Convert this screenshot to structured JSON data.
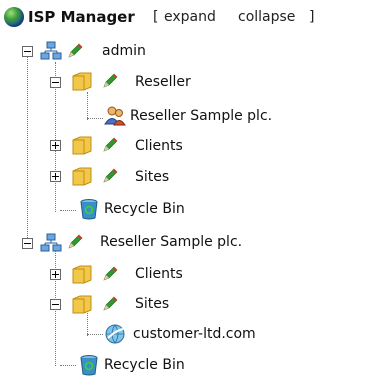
{
  "header": {
    "title": "ISP Manager",
    "open_bracket": "[",
    "expand_label": "expand",
    "collapse_label": "collapse",
    "close_bracket": "]"
  },
  "tree": {
    "admin": {
      "label": "admin",
      "reseller": {
        "label": "Reseller",
        "child": "Reseller Sample plc."
      },
      "clients": "Clients",
      "sites": "Sites",
      "recycle": "Recycle Bin"
    },
    "reseller_sample": {
      "label": "Reseller Sample plc.",
      "clients": "Clients",
      "sites": {
        "label": "Sites",
        "child": "customer-ltd.com"
      },
      "recycle": "Recycle Bin"
    }
  },
  "colors": {
    "folder": "#f2c84b",
    "pencil_body": "#2e9a2e",
    "pencil_tip": "#d23a2a",
    "bin": "#3a8fc7"
  }
}
